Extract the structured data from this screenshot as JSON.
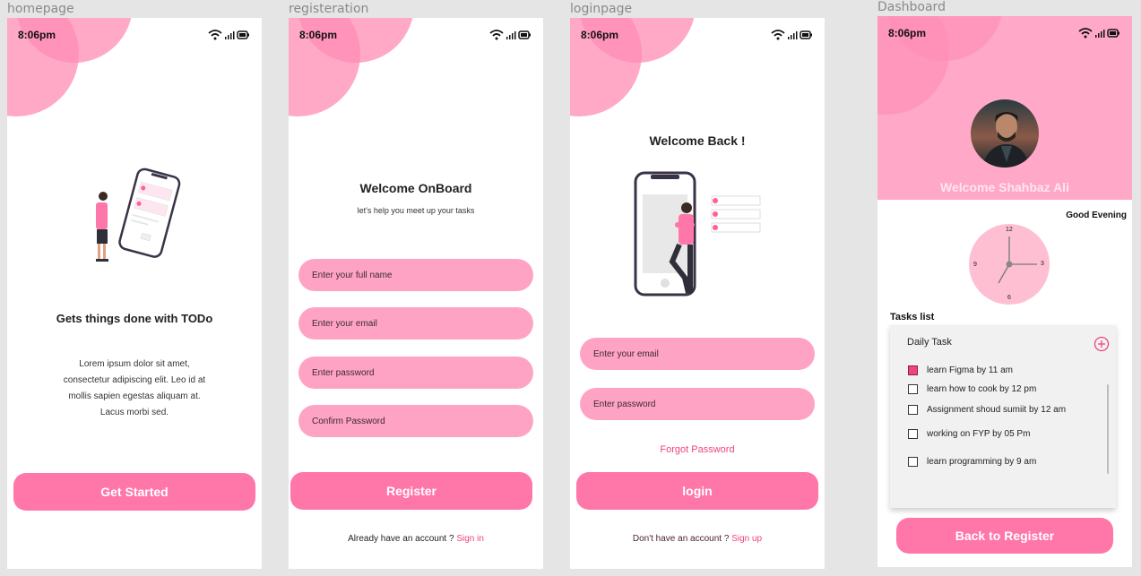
{
  "frames": {
    "homepage": "homepage",
    "registration": "registeration",
    "login": "loginpage",
    "dashboard": "Dashboard"
  },
  "status": {
    "time": "8:06pm"
  },
  "homepage": {
    "title": "Gets things done with TODo",
    "body_lines": [
      "Lorem ipsum dolor sit amet,",
      "consectetur adipiscing elit. Leo id at",
      "mollis sapien egestas aliquam at.",
      "Lacus morbi sed."
    ],
    "button": "Get Started"
  },
  "register": {
    "title": "Welcome OnBoard",
    "subtitle": "let's help you meet up your tasks",
    "fields": [
      "Enter your full name",
      "Enter your email",
      "Enter password",
      "Confirm Password"
    ],
    "button": "Register",
    "footer_text": "Already have an account ?",
    "footer_link": "Sign in"
  },
  "login": {
    "title": "Welcome Back !",
    "fields": [
      "Enter your email",
      "Enter password"
    ],
    "forgot": "Forgot Password",
    "button": "login",
    "footer_text": "Don't have an account ?",
    "footer_link": "Sign up"
  },
  "dashboard": {
    "welcome": "Welcome Shahbaz Ali",
    "greeting": "Good Evening",
    "clock_numbers": {
      "twelve": "12",
      "three": "3",
      "six": "6",
      "nine": "9"
    },
    "tasks_heading": "Tasks list",
    "card_title": "Daily Task",
    "tasks": [
      {
        "label": "learn Figma by 11 am",
        "checked": true
      },
      {
        "label": "learn how to cook by 12 pm",
        "checked": false
      },
      {
        "label": "Assignment shoud sumiit  by 12 am",
        "checked": false
      },
      {
        "label": "working on FYP by 05 Pm",
        "checked": false
      },
      {
        "label": "learn programming by 9 am",
        "checked": false
      }
    ],
    "button": "Back to Register"
  },
  "colors": {
    "primary_pink": "#ff76a8",
    "input_pink": "#ffa3c4",
    "accent": "#f0437f",
    "dashboard_header": "#ffa8c8"
  },
  "icons": [
    "wifi-icon",
    "signal-icon",
    "battery-icon",
    "add-circle-icon",
    "avatar",
    "clock"
  ]
}
